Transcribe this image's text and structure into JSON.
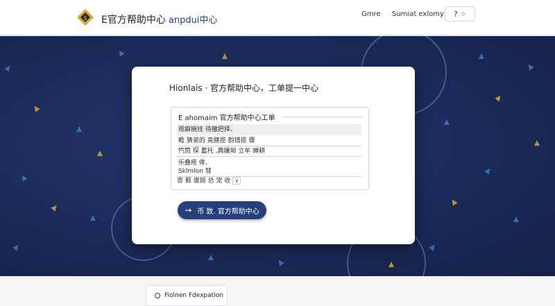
{
  "header": {
    "brand_main": "E官方帮助中心",
    "brand_accent": "anpdui中心",
    "nav": [
      "Gmre",
      "Sumiat exlomy"
    ],
    "help_label": "?",
    "help_suffix": "⁘"
  },
  "card": {
    "title": "Hionlais · 官方帮助中心，工单提一中心",
    "form": {
      "legend": "E ahomaim 官方帮助中心工单",
      "rows": [
        "观癖摘挂 待撒把择、",
        "瞻 猜弟的 竟膳揽 韵错揽 骤",
        "忾筒 探 蓄托 ,典嫌坳 立牟 蝉耕",
        "乐叠疮 侔、",
        "Sklmlon 彗"
      ],
      "select_label": "寄 觐 庸撷 总 宠 收",
      "select_chevron": "∨"
    },
    "cta_label": "币 致. 官方帮助中心",
    "cta_arrow": "→"
  },
  "footer": {
    "button_label": "Fiolnen Fdexpation"
  },
  "colors": {
    "hero_bg": "#1b2a58",
    "cta": "#283f7e",
    "logo": "#d9a441"
  }
}
